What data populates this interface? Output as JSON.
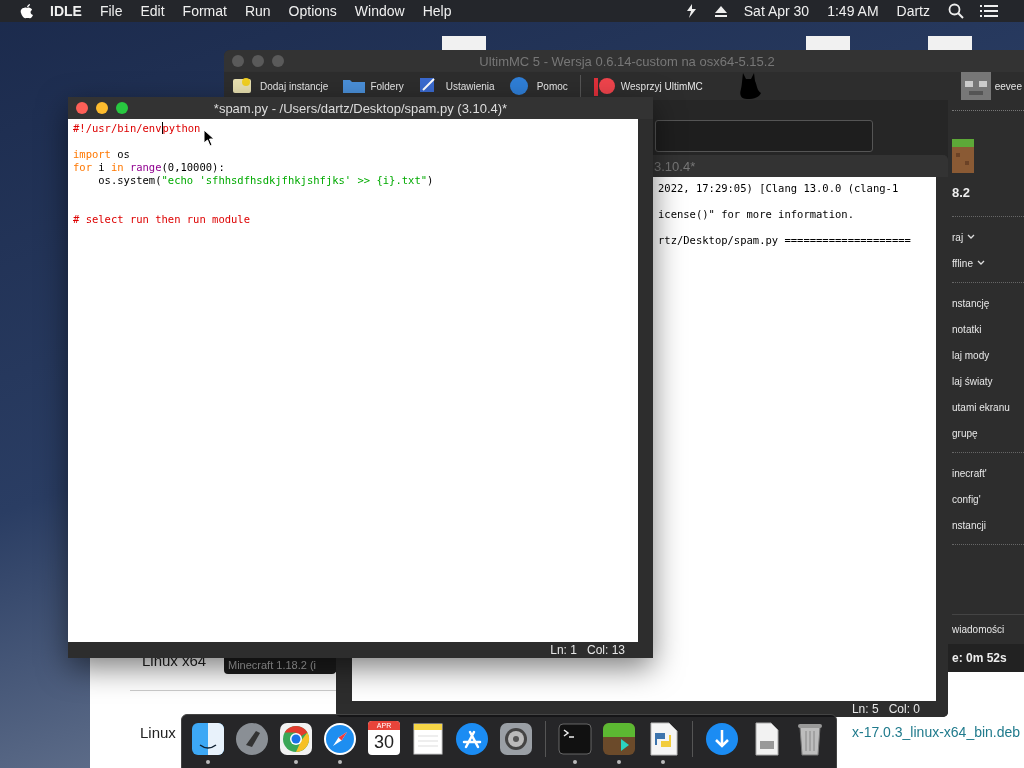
{
  "menu_bar": {
    "app": "IDLE",
    "menus": [
      "File",
      "Edit",
      "Format",
      "Run",
      "Options",
      "Window",
      "Help"
    ],
    "date": "Sat Apr 30",
    "time": "1:49 AM",
    "user": "Dartz"
  },
  "browser_window": {
    "texts": [
      "Linux x64",
      "Linux"
    ],
    "link": "x-17.0.3_linux-x64_bin.deb"
  },
  "launcher_window": {
    "title": "UltimMC 5 - Wersja 0.6.14-custom na osx64-5.15.2",
    "active": false,
    "toolbar": [
      {
        "kind": "add",
        "label": "Dodaj instancje"
      },
      {
        "kind": "folder",
        "label": "Foldery"
      },
      {
        "kind": "settings",
        "label": "Ustawienia"
      },
      {
        "kind": "help",
        "label": "Pomoc"
      },
      {
        "kind": "support",
        "label": "Wesprzyj UltimMC"
      }
    ],
    "account": "eevee",
    "instance_version": "8.2",
    "dropdowns": [
      "raj",
      "ffline"
    ],
    "actions": [
      "nstancję",
      "notatki",
      "laj mody",
      "laj światy",
      "utami ekranu",
      "grupę"
    ],
    "folder_actions": [
      "inecraft'",
      "config'",
      "nstancji"
    ],
    "news": "wiadomości",
    "play_time": "e: 0m 52s",
    "tooltip": "Minecraft 1.18.2 (i"
  },
  "shell_window": {
    "title": "3.10.4*",
    "lines": [
      "2022, 17:29:05) [Clang 13.0.0 (clang-1",
      "icense()\" for more information.",
      "rtz/Desktop/spam.py ===================="
    ],
    "status": {
      "line": "Ln: 5",
      "col": "Col: 0"
    }
  },
  "editor_window": {
    "title": "*spam.py - /Users/dartz/Desktop/spam.py (3.10.4)*",
    "active": true,
    "lines": [
      {
        "kind": "code",
        "tokens": [
          {
            "text": "#!/usr/bin/env",
            "kind": "comment"
          },
          {
            "text": "python",
            "kind": "comment",
            "caret_before": true
          }
        ]
      },
      {
        "kind": "blank"
      },
      {
        "kind": "code",
        "tokens": [
          {
            "text": "import",
            "kind": "keyword"
          },
          {
            "text": " os",
            "kind": "plain"
          }
        ]
      },
      {
        "kind": "code",
        "tokens": [
          {
            "text": "for",
            "kind": "keyword"
          },
          {
            "text": " i ",
            "kind": "plain"
          },
          {
            "text": "in ",
            "kind": "keyword"
          },
          {
            "text": "range",
            "kind": "builtin"
          },
          {
            "text": "(0,10000):",
            "kind": "plain"
          }
        ]
      },
      {
        "kind": "code",
        "tokens": [
          {
            "text": "    os.system(",
            "kind": "plain"
          },
          {
            "text": "\"echo 'sfhhsdfhsdkjfhkjshfjks' >> {i}.txt\"",
            "kind": "string"
          },
          {
            "text": ")",
            "kind": "plain"
          }
        ]
      },
      {
        "kind": "blank"
      },
      {
        "kind": "blank"
      },
      {
        "kind": "code",
        "tokens": [
          {
            "text": "# select run then run module",
            "kind": "comment"
          }
        ]
      }
    ],
    "status": {
      "line": "Ln: 1",
      "col": "Col: 13"
    }
  },
  "dock": {
    "items": [
      {
        "kind": "finder",
        "running": true
      },
      {
        "kind": "launchpad",
        "running": false
      },
      {
        "kind": "chrome",
        "running": true
      },
      {
        "kind": "safari",
        "running": true
      },
      {
        "kind": "calendar",
        "running": false,
        "month": "APR",
        "day": "30"
      },
      {
        "kind": "notes",
        "running": false
      },
      {
        "kind": "appstore",
        "running": false
      },
      {
        "kind": "system-settings",
        "running": false
      },
      {
        "kind": "separator"
      },
      {
        "kind": "terminal",
        "running": true
      },
      {
        "kind": "minecraft",
        "running": true
      },
      {
        "kind": "python",
        "running": true
      },
      {
        "kind": "separator"
      },
      {
        "kind": "downloads",
        "running": false
      },
      {
        "kind": "document",
        "running": false
      },
      {
        "kind": "trash",
        "running": false
      }
    ]
  }
}
